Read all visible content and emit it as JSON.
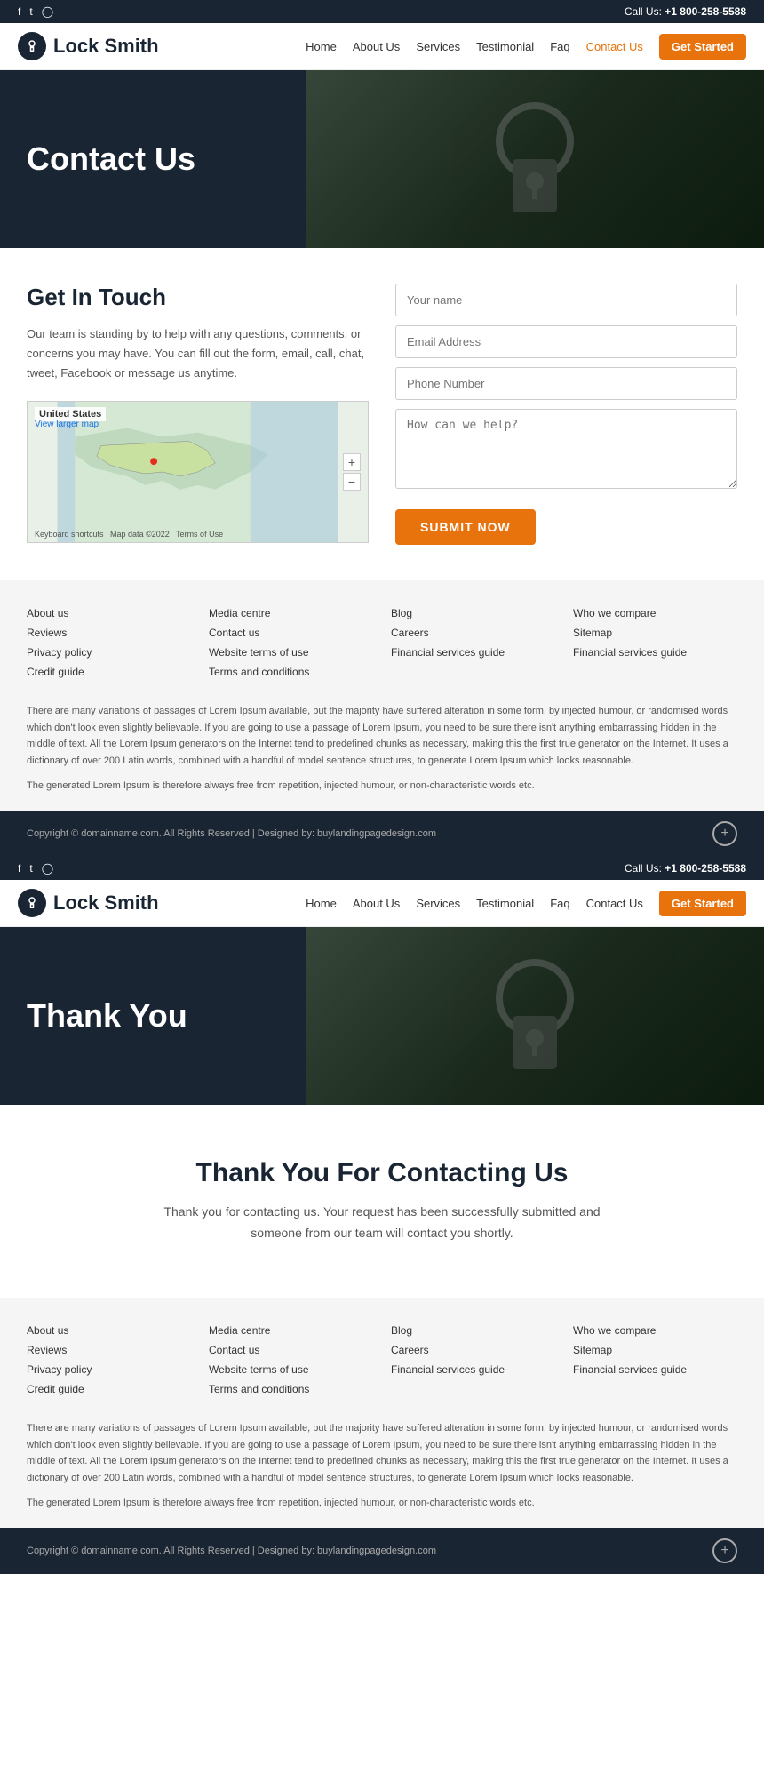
{
  "topbar": {
    "call_label": "Call Us:",
    "phone": "+1 800-258-5588",
    "social": [
      "f",
      "t",
      "i"
    ]
  },
  "header": {
    "logo_text": "Lock Smith",
    "nav": [
      {
        "label": "Home",
        "href": "#"
      },
      {
        "label": "About Us",
        "href": "#"
      },
      {
        "label": "Services",
        "href": "#"
      },
      {
        "label": "Testimonial",
        "href": "#"
      },
      {
        "label": "Faq",
        "href": "#"
      },
      {
        "label": "Contact Us",
        "href": "#",
        "active": true
      }
    ],
    "cta": "Get Started"
  },
  "hero": {
    "title": "Contact Us"
  },
  "get_in_touch": {
    "title": "Get In Touch",
    "description": "Our team is standing by to help with any questions, comments, or concerns you may have. You can fill out the form, email, call, chat, tweet, Facebook or message us anytime.",
    "map_label": "United States",
    "map_link": "View larger map"
  },
  "form": {
    "name_placeholder": "Your name",
    "email_placeholder": "Email Address",
    "phone_placeholder": "Phone Number",
    "message_placeholder": "How can we help?",
    "submit_label": "SUBMIT NOW"
  },
  "footer": {
    "col1": [
      {
        "label": "About us"
      },
      {
        "label": "Reviews"
      },
      {
        "label": "Privacy policy"
      },
      {
        "label": "Credit guide"
      }
    ],
    "col2": [
      {
        "label": "Media centre"
      },
      {
        "label": "Contact us"
      },
      {
        "label": "Website terms of use"
      },
      {
        "label": "Terms and conditions"
      }
    ],
    "col3": [
      {
        "label": "Blog"
      },
      {
        "label": "Careers"
      },
      {
        "label": "Financial services guide"
      }
    ],
    "col4": [
      {
        "label": "Who we compare"
      },
      {
        "label": "Sitemap"
      },
      {
        "label": "Financial services guide"
      }
    ],
    "lorem1": "There are many variations of passages of Lorem Ipsum available, but the majority have suffered alteration in some form, by injected humour, or randomised words which don't look even slightly believable. If you are going to use a passage of Lorem Ipsum, you need to be sure there isn't anything embarrassing hidden in the middle of text. All the Lorem Ipsum generators on the Internet tend to predefined chunks as necessary, making this the first true generator on the Internet. It uses a dictionary of over 200 Latin words, combined with a handful of model sentence structures, to generate Lorem Ipsum which looks reasonable.",
    "lorem2": "The generated Lorem Ipsum is therefore always free from repetition, injected humour, or non-characteristic words etc."
  },
  "copyright": {
    "text": "Copyright © domainname.com. All Rights Reserved | Designed by: buylandingpagedesign.com"
  },
  "page2": {
    "hero_title": "Thank You",
    "thankyou_title": "Thank You For Contacting Us",
    "thankyou_desc": "Thank you for contacting us. Your request has been successfully submitted and someone from our team will contact you shortly."
  }
}
